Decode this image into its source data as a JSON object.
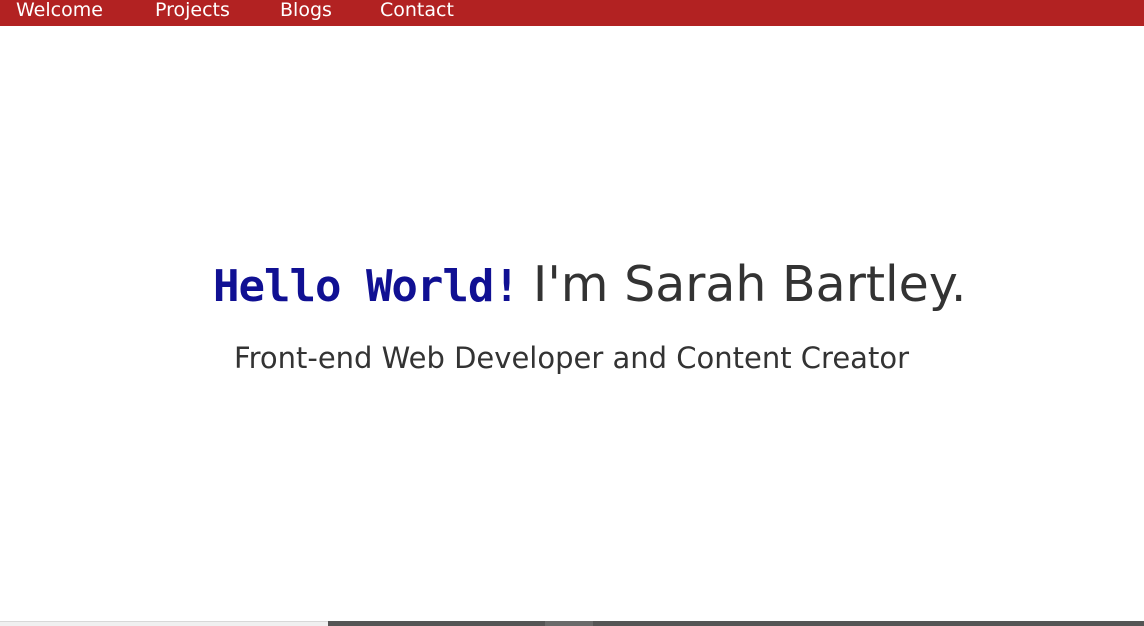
{
  "nav": {
    "items": [
      {
        "label": "Welcome"
      },
      {
        "label": "Projects"
      },
      {
        "label": "Blogs"
      },
      {
        "label": "Contact"
      }
    ],
    "background_color": "#b22222",
    "text_color": "#ffffff"
  },
  "hero": {
    "greeting": "Hello World!",
    "intro": "I'm Sarah Bartley.",
    "subtitle": "Front-end Web Developer and Content Creator",
    "greeting_color": "#101093",
    "text_color": "#333333"
  }
}
